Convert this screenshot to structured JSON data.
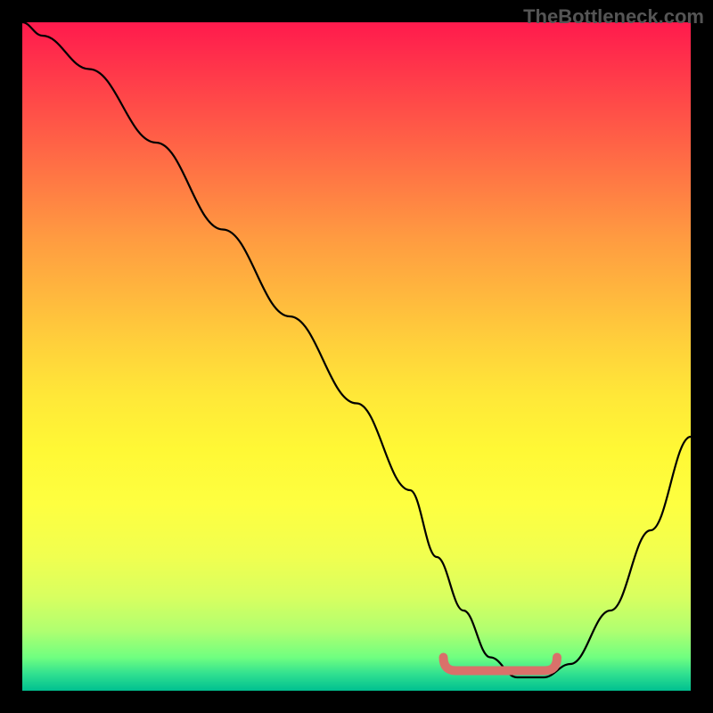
{
  "watermark": "TheBottleneck.com",
  "chart_data": {
    "type": "line",
    "title": "",
    "xlabel": "",
    "ylabel": "",
    "xlim": [
      0,
      100
    ],
    "ylim": [
      0,
      100
    ],
    "series": [
      {
        "name": "bottleneck-curve",
        "x": [
          0,
          3,
          10,
          20,
          30,
          40,
          50,
          58,
          62,
          66,
          70,
          74,
          78,
          82,
          88,
          94,
          100
        ],
        "values": [
          100,
          98,
          93,
          82,
          69,
          56,
          43,
          30,
          20,
          12,
          5,
          2,
          2,
          4,
          12,
          24,
          38
        ]
      }
    ],
    "marker": {
      "name": "optimal-range-marker",
      "x_start": 63,
      "x_end": 80,
      "y": 3,
      "color": "#d9716a"
    },
    "gradient_stops": [
      {
        "pos": 0,
        "color": "#ff1a4d"
      },
      {
        "pos": 50,
        "color": "#ffd83b"
      },
      {
        "pos": 80,
        "color": "#f0ff50"
      },
      {
        "pos": 100,
        "color": "#00c090"
      }
    ]
  }
}
